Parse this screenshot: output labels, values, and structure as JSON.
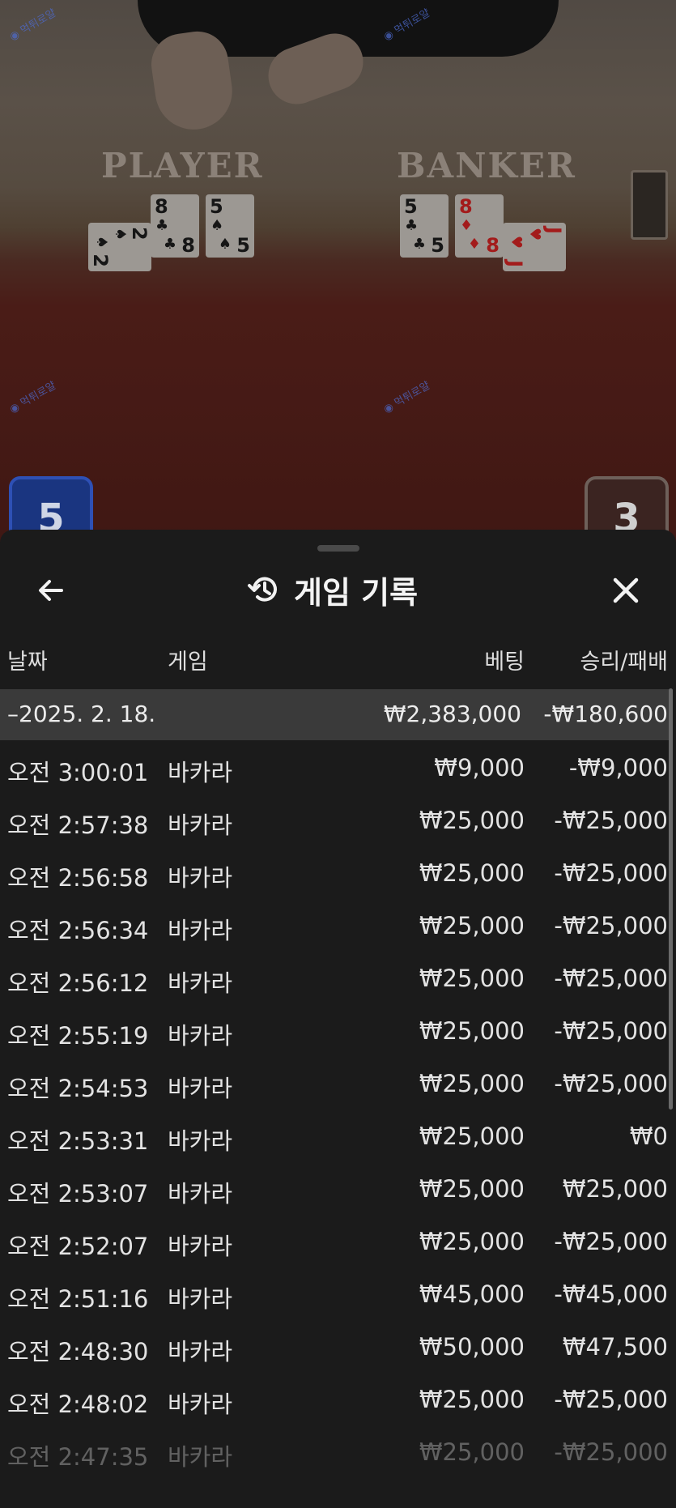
{
  "table": {
    "player_label": "PLAYER",
    "banker_label": "BANKER",
    "player_cards": [
      {
        "rank": "2",
        "suit": "♠",
        "color": "black",
        "rotated": true
      },
      {
        "rank": "8",
        "suit": "♣",
        "color": "black",
        "rotated": false
      },
      {
        "rank": "5",
        "suit": "♠",
        "color": "black",
        "rotated": false
      }
    ],
    "banker_cards": [
      {
        "rank": "5",
        "suit": "♣",
        "color": "black",
        "rotated": false
      },
      {
        "rank": "8",
        "suit": "♦",
        "color": "red",
        "rotated": false
      },
      {
        "rank": "J",
        "suit": "♥",
        "color": "red",
        "rotated": true
      }
    ],
    "player_score": "5",
    "banker_score": "3"
  },
  "sheet": {
    "title": "게임 기록",
    "icons": {
      "back": "arrow-left-icon",
      "history": "history-icon",
      "close": "close-icon"
    },
    "columns": {
      "date": "날짜",
      "game": "게임",
      "bet": "베팅",
      "result": "승리/패배"
    },
    "summary": {
      "date": "–2025. 2. 18.",
      "bet": "₩2,383,000",
      "result": "-₩180,600"
    },
    "rows": [
      {
        "time": "오전 3:00:01",
        "game": "바카라",
        "bet": "₩9,000",
        "result": "-₩9,000"
      },
      {
        "time": "오전 2:57:38",
        "game": "바카라",
        "bet": "₩25,000",
        "result": "-₩25,000"
      },
      {
        "time": "오전 2:56:58",
        "game": "바카라",
        "bet": "₩25,000",
        "result": "-₩25,000"
      },
      {
        "time": "오전 2:56:34",
        "game": "바카라",
        "bet": "₩25,000",
        "result": "-₩25,000"
      },
      {
        "time": "오전 2:56:12",
        "game": "바카라",
        "bet": "₩25,000",
        "result": "-₩25,000"
      },
      {
        "time": "오전 2:55:19",
        "game": "바카라",
        "bet": "₩25,000",
        "result": "-₩25,000"
      },
      {
        "time": "오전 2:54:53",
        "game": "바카라",
        "bet": "₩25,000",
        "result": "-₩25,000"
      },
      {
        "time": "오전 2:53:31",
        "game": "바카라",
        "bet": "₩25,000",
        "result": "₩0"
      },
      {
        "time": "오전 2:53:07",
        "game": "바카라",
        "bet": "₩25,000",
        "result": "₩25,000"
      },
      {
        "time": "오전 2:52:07",
        "game": "바카라",
        "bet": "₩25,000",
        "result": "-₩25,000"
      },
      {
        "time": "오전 2:51:16",
        "game": "바카라",
        "bet": "₩45,000",
        "result": "-₩45,000"
      },
      {
        "time": "오전 2:48:30",
        "game": "바카라",
        "bet": "₩50,000",
        "result": "₩47,500"
      },
      {
        "time": "오전 2:48:02",
        "game": "바카라",
        "bet": "₩25,000",
        "result": "-₩25,000"
      },
      {
        "time": "오전 2:47:35",
        "game": "바카라",
        "bet": "₩25,000",
        "result": "-₩25,000"
      }
    ]
  },
  "colors": {
    "player": "#1a3580",
    "banker": "#3b2421",
    "summary_bg": "#3a3a3a",
    "sheet_bg": "#1b1b1b"
  }
}
